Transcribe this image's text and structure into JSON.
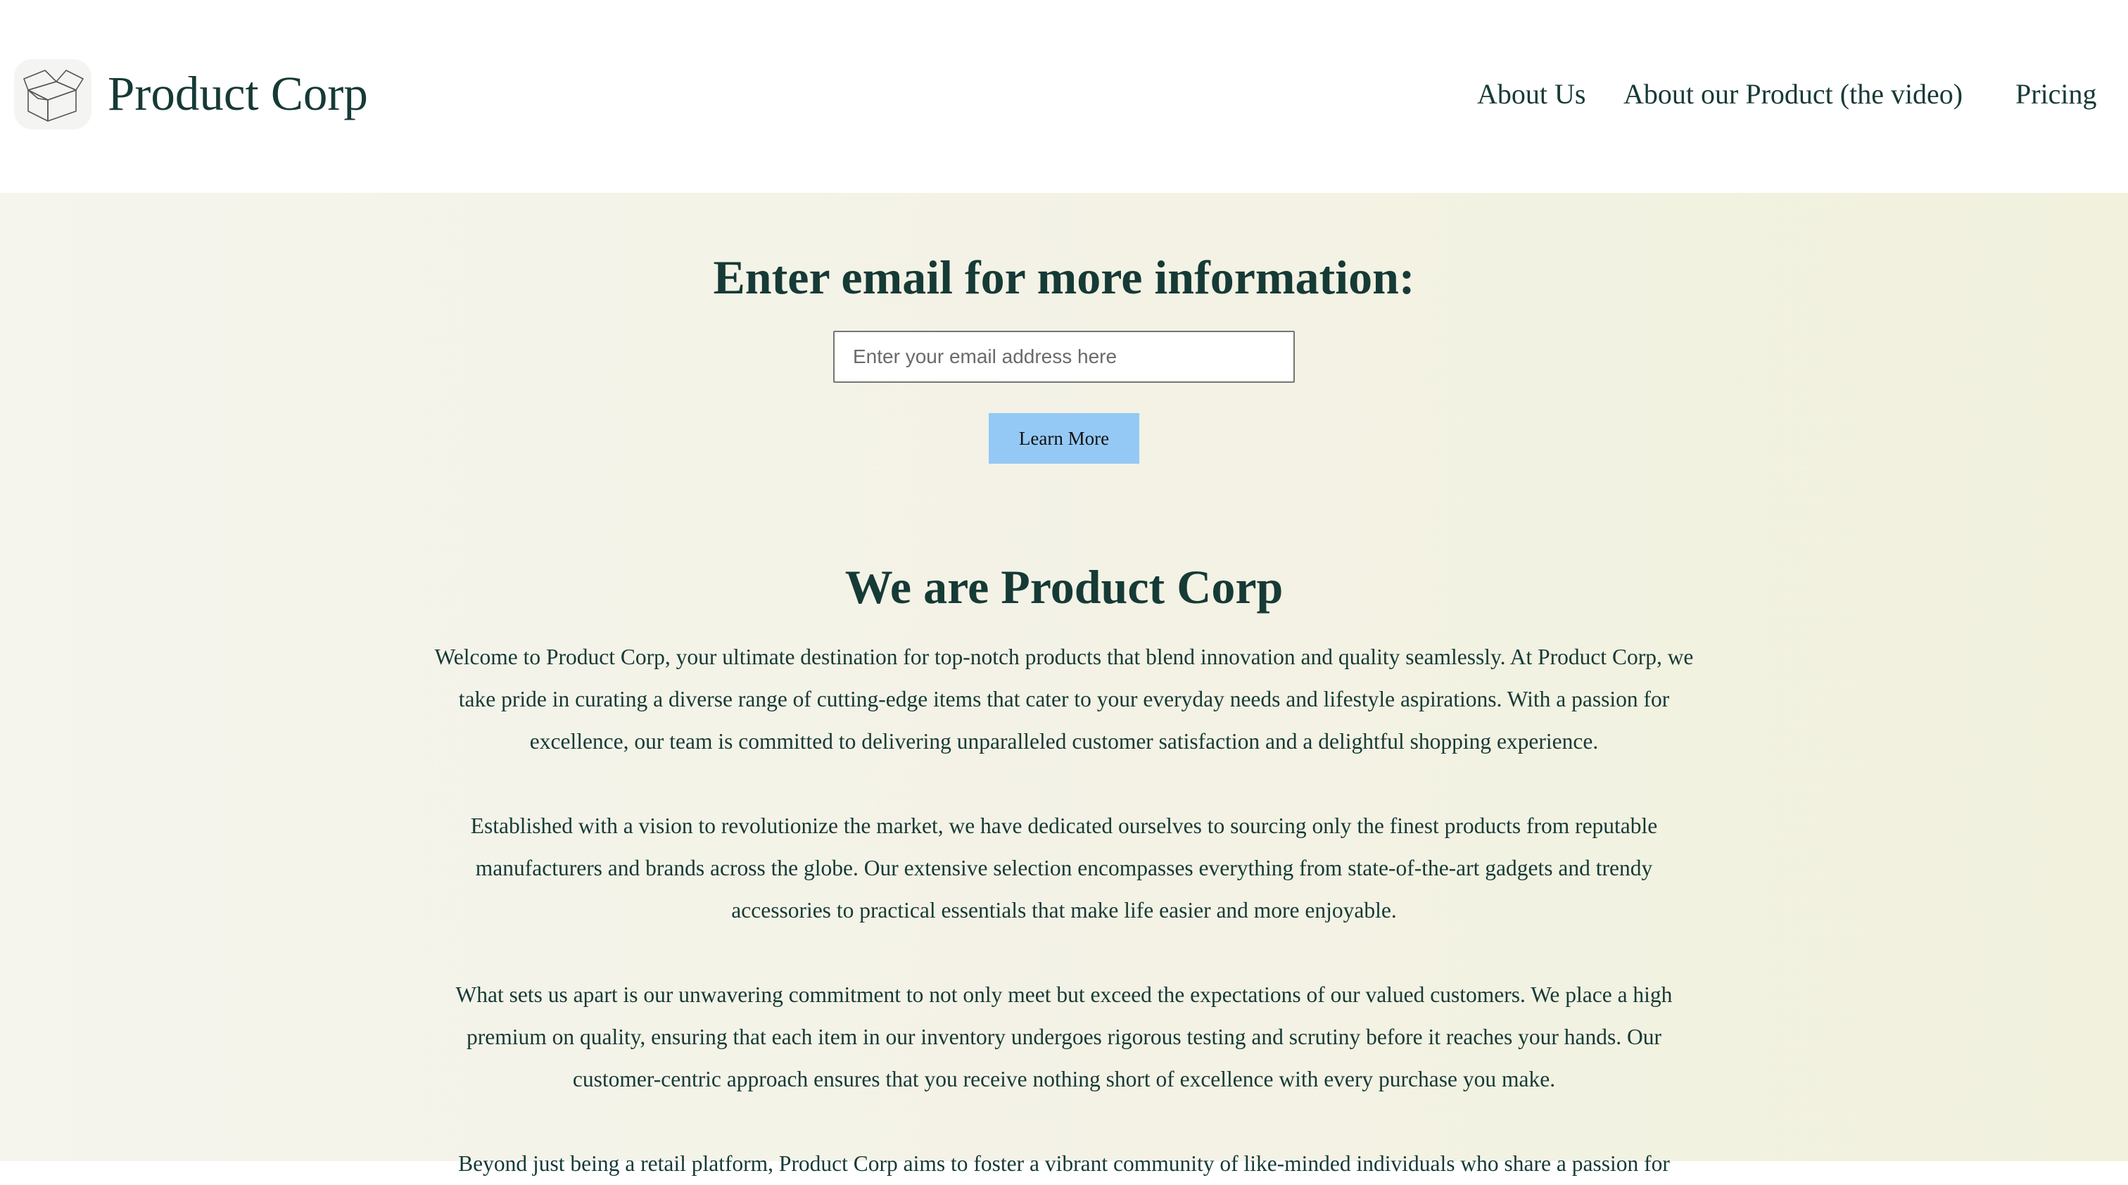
{
  "header": {
    "brand": "Product Corp",
    "logo_icon": "open-box-icon",
    "nav": [
      {
        "label": "About Us"
      },
      {
        "label": "About our Product (the video)"
      },
      {
        "label": "Pricing"
      }
    ]
  },
  "signup": {
    "heading": "Enter email for more information:",
    "email_placeholder": "Enter your email address here",
    "email_value": "",
    "button_label": "Learn More"
  },
  "about": {
    "heading": "We are Product Corp",
    "paragraphs": [
      "Welcome to Product Corp, your ultimate destination for top-notch products that blend innovation and quality seamlessly. At Product Corp, we take pride in curating a diverse range of cutting-edge items that cater to your everyday needs and lifestyle aspirations. With a passion for excellence, our team is committed to delivering unparalleled customer satisfaction and a delightful shopping experience.",
      "Established with a vision to revolutionize the market, we have dedicated ourselves to sourcing only the finest products from reputable manufacturers and brands across the globe. Our extensive selection encompasses everything from state-of-the-art gadgets and trendy accessories to practical essentials that make life easier and more enjoyable.",
      "What sets us apart is our unwavering commitment to not only meet but exceed the expectations of our valued customers. We place a high premium on quality, ensuring that each item in our inventory undergoes rigorous testing and scrutiny before it reaches your hands. Our customer-centric approach ensures that you receive nothing short of excellence with every purchase you make.",
      "Beyond just being a retail platform, Product Corp aims to foster a vibrant community of like-minded individuals who share a passion for"
    ]
  },
  "colors": {
    "text": "#163a36",
    "button": "#95c9f5",
    "background": "#f3f2e4"
  }
}
